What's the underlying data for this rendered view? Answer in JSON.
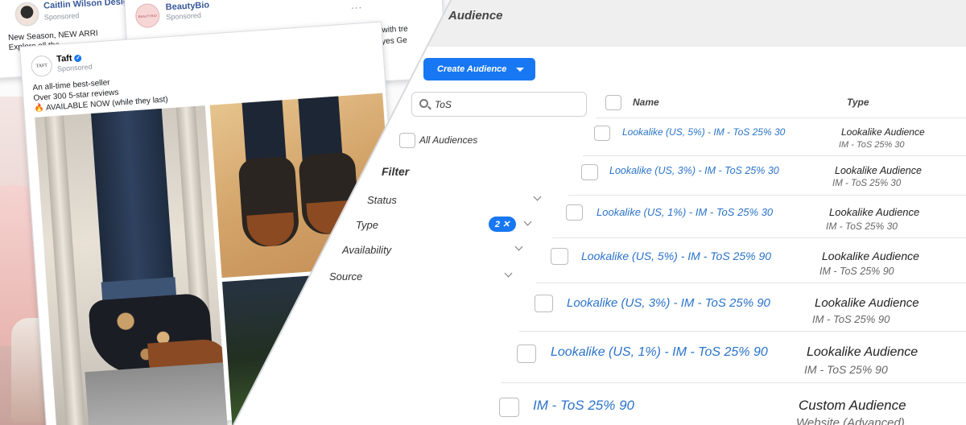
{
  "ads": {
    "caitlin": {
      "page_name": "Caitlin Wilson Design",
      "sponsored": "Sponsored",
      "body_line1": "New Season, NEW ARRI",
      "body_line2": "Explore all the"
    },
    "beautybio": {
      "page_name": "BeautyBio",
      "sponsored": "Sponsored",
      "avatar_text": "BEAUTYBIO",
      "body_line1": "ting with tre",
      "body_line2": "ht Eyes Ge"
    },
    "taft": {
      "page_name": "Taft",
      "sponsored": "Sponsored",
      "logo_text": "TAFT",
      "body_line1": "An all-time best-seller",
      "body_line2": "Over 300 5-star reviews",
      "body_line3": "🔥 AVAILABLE NOW (while they last)"
    },
    "more_dots": "···"
  },
  "audience": {
    "title": "Audience",
    "create_button": "Create Audience",
    "search_value": "ToS",
    "all_audiences_label": "All Audiences",
    "filter_title": "Filter",
    "filters": {
      "status": "Status",
      "type": "Type",
      "type_badge_count": "2",
      "type_badge_close": "✕",
      "availability": "Availability",
      "source": "Source"
    },
    "columns": {
      "name": "Name",
      "type": "Type"
    },
    "rows": [
      {
        "name": "Lookalike (US, 5%) - IM - ToS 25% 30",
        "type": "Lookalike Audience",
        "sub": "IM - ToS 25% 30"
      },
      {
        "name": "Lookalike (US, 3%) - IM - ToS 25% 30",
        "type": "Lookalike Audience",
        "sub": "IM - ToS 25% 30"
      },
      {
        "name": "Lookalike (US, 1%) - IM - ToS 25% 30",
        "type": "Lookalike Audience",
        "sub": "IM - ToS 25% 30"
      },
      {
        "name": "Lookalike (US, 5%) - IM - ToS 25% 90",
        "type": "Lookalike Audience",
        "sub": "IM - ToS 25% 90"
      },
      {
        "name": "Lookalike (US, 3%) - IM - ToS 25% 90",
        "type": "Lookalike Audience",
        "sub": "IM - ToS 25% 90"
      },
      {
        "name": "Lookalike (US, 1%) - IM - ToS 25% 90",
        "type": "Lookalike Audience",
        "sub": "IM - ToS 25% 90"
      },
      {
        "name": "IM - ToS 25% 90",
        "type": "Custom Audience",
        "sub": "Website (Advanced)"
      }
    ]
  },
  "colors": {
    "facebook_blue": "#1877f2",
    "link_blue": "#2a73c9",
    "header_gray": "#efefef"
  }
}
